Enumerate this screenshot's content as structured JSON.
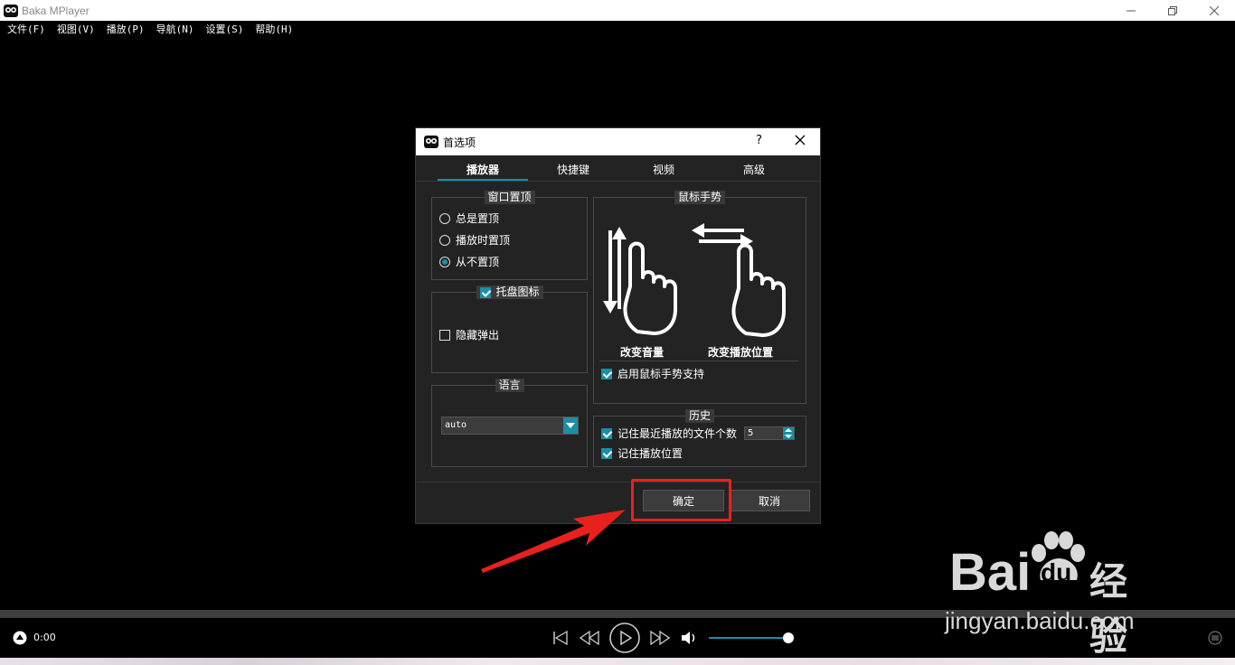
{
  "window": {
    "title": "Baka MPlayer"
  },
  "menu": [
    "文件(F)",
    "视图(V)",
    "播放(P)",
    "导航(N)",
    "设置(S)",
    "帮助(H)"
  ],
  "dialog": {
    "title": "首选项",
    "help": "?",
    "tabs": [
      "播放器",
      "快捷键",
      "视频",
      "高级"
    ],
    "window_ontop": {
      "title": "窗口置顶",
      "options": [
        "总是置顶",
        "播放时置顶",
        "从不置顶"
      ],
      "selected": 2
    },
    "tray": {
      "title": "托盘图标",
      "checked": true,
      "hide_popup": "隐藏弹出"
    },
    "language": {
      "title": "语言",
      "value": "auto"
    },
    "gesture": {
      "title": "鼠标手势",
      "label_volume": "改变音量",
      "label_seek": "改变播放位置",
      "enable": "启用鼠标手势支持"
    },
    "history": {
      "title": "历史",
      "recent_files": "记住最近播放的文件个数",
      "recent_count": "5",
      "remember_pos": "记住播放位置"
    },
    "ok": "确定",
    "cancel": "取消"
  },
  "player": {
    "time": "0:00",
    "volume_level": 0.92
  },
  "watermark": {
    "brand": "Bai",
    "brand2": "du",
    "cn": "经验",
    "url": "jingyan.baidu.com"
  },
  "colors": {
    "accent": "#1a8fa8",
    "highlight": "#e8211e"
  }
}
